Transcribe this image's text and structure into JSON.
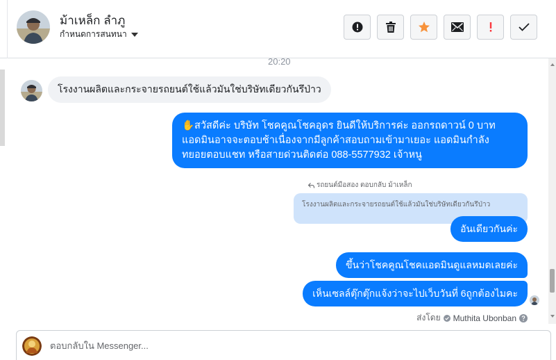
{
  "header": {
    "contact_name": "ม้าเหล็ก ลำภู",
    "assign_label": "กำหนดการสนทนา",
    "actions": [
      {
        "name": "report-button",
        "icon": "alert-circle-icon",
        "color": "#1c1e21"
      },
      {
        "name": "delete-button",
        "icon": "trash-icon",
        "color": "#1c1e21"
      },
      {
        "name": "star-button",
        "icon": "star-icon",
        "color": "#f7923b"
      },
      {
        "name": "mark-unread-button",
        "icon": "envelope-icon",
        "color": "#1c1e21"
      },
      {
        "name": "spam-button",
        "icon": "exclamation-icon",
        "color": "#fa383e"
      },
      {
        "name": "mark-done-button",
        "icon": "check-icon",
        "color": "#1c1e21"
      }
    ]
  },
  "conversation": {
    "timestamp": "20:20",
    "incoming_message": "โรงงานผลิตและกระจายรถยนต์ใช้แล้วมันใช่บริษัทเดียวกันรึป่าว",
    "auto_reply": {
      "line1": "✋สวัสดีค่ะ บริษัท โชคคูณโชคอุดร ยินดีให้บริการค่ะ ออกรถดาวน์ 0 บาท",
      "line2": "แอดมินอาจจะตอบช้าเนื่องจากมีลูกค้าสอบถามเข้ามาเยอะ แอดมินกำลัง",
      "line3": "ทยอยตอบแชท หรือสายด่วนติดต่อ 088-5577932 เจ้าหนู"
    },
    "reply_meta": "รถยนต์มือสอง ตอบกลับ ม้าเหล็ก",
    "quoted_message": "โรงงานผลิตและกระจายรถยนต์ใช้แล้วมันใช่บริษัทเดียวกันรึป่าว",
    "reply_message": "อันเดียวกันค่ะ",
    "message_2": "ขึ้นว่าโชคคูณโชคแอดมินดูแลหมดเลยค่ะ",
    "message_3": "เห็นเซลล์ตุ๊กตุ๊กแจ้งว่าจะไปเว็บวันที่ 6ถูกต้องไมคะ",
    "sent_by_label": "ส่งโดย",
    "sent_by_name": "Muthita Ubonban"
  },
  "composer": {
    "placeholder": "ตอบกลับใน Messenger..."
  },
  "colors": {
    "accent": "#0a7cff",
    "quote_bg": "#cfe3fb",
    "incoming_bg": "#f0f2f5",
    "star": "#f7923b",
    "spam": "#fa383e"
  }
}
